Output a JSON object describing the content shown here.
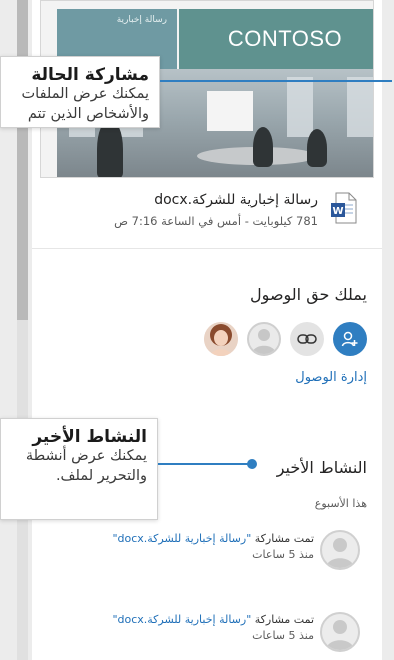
{
  "thumbnail": {
    "brand_text": "CONTOSO",
    "mini_header_text": "رسالة إخبارية"
  },
  "file": {
    "name": "رسالة إخبارية للشركة.docx",
    "meta": "781 كيلوبايت - أمس في الساعة 7:16 ص",
    "icon": "word-document-icon"
  },
  "access": {
    "title": "يملك حق الوصول",
    "manage_label": "إدارة الوصول",
    "icons": [
      "add-person-icon",
      "link-icon",
      "person-placeholder-icon",
      "person-photo-avatar"
    ]
  },
  "activity": {
    "title": "النشاط الأخير",
    "period": "هذا الأسبوع",
    "items": [
      {
        "action": "تمت مشاركة ",
        "file": "\"رسالة إخبارية للشركة.docx\"",
        "time": "منذ 5 ساعات"
      },
      {
        "action": "تمت مشاركة ",
        "file": "\"رسالة إخبارية للشركة.docx\"",
        "time": "منذ 5 ساعات"
      }
    ]
  },
  "callouts": {
    "sharing": {
      "title": "مشاركة الحالة",
      "line1": "يمكنك عرض الملفات",
      "line2": "والأشخاص الذين تتم"
    },
    "recent": {
      "title": "النشاط الأخير",
      "line1": "يمكنك عرض أنشطة",
      "line2": "والتحرير لملف."
    }
  },
  "colors": {
    "accent": "#2f7ec1",
    "link": "#1f6fb8",
    "banner": "#5f928f"
  }
}
